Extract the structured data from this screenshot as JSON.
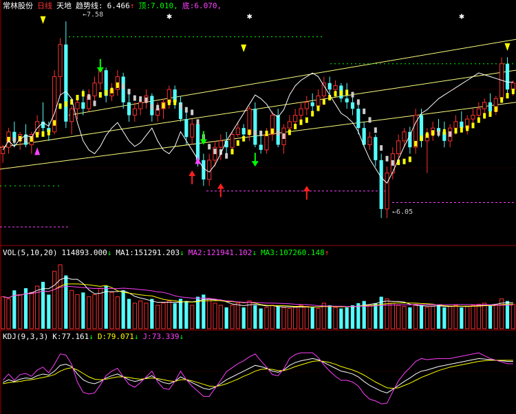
{
  "stock": {
    "name": "常林股份",
    "period": "日线",
    "indicator": "天地",
    "trend_label": "趋势线:",
    "trend_value": "6.466",
    "top_label": "顶:",
    "top_value": "7.010,",
    "bottom_label": "底:",
    "bottom_value": "6.070,",
    "down_arrow": "↓",
    "up_arrow": "↑"
  },
  "price_annotations": {
    "high": "7.58",
    "low": "6.05"
  },
  "volume": {
    "title": "VOL(5,10,20)",
    "vol_value": "114893.000",
    "ma1_label": "MA1:",
    "ma1_value": "151291.203",
    "ma2_label": "MA2:",
    "ma2_value": "121941.102",
    "ma3_label": "MA3:",
    "ma3_value": "107260.148"
  },
  "kdj": {
    "title": "KDJ(9,3,3)",
    "k_label": "K:",
    "k_value": "77.161",
    "d_label": "D:",
    "d_value": "79.071",
    "j_label": "J:",
    "j_value": "73.339"
  },
  "colors": {
    "background": "#000000",
    "up_candle": "#ff3030",
    "down_candle": "#54ffff",
    "trend_up": "#ffff00",
    "trend_down": "#cccccc",
    "channel": "#ffff80",
    "top_line": "#00ff00",
    "bottom_line": "#ff40ff",
    "kdj_k": "#ffffff",
    "kdj_d": "#ffff00",
    "kdj_j": "#ff40ff",
    "grid": "#a00000"
  },
  "chart_data": {
    "type": "candlestick",
    "price_range": [
      5.9,
      7.65
    ],
    "volume_range": [
      0,
      300000
    ],
    "kdj_range": [
      -10,
      110
    ],
    "candles": [
      [
        6.55,
        6.62,
        6.48,
        6.6
      ],
      [
        6.6,
        6.75,
        6.55,
        6.72
      ],
      [
        6.72,
        6.8,
        6.6,
        6.65
      ],
      [
        6.65,
        6.72,
        6.58,
        6.7
      ],
      [
        6.7,
        6.78,
        6.6,
        6.62
      ],
      [
        6.62,
        6.72,
        6.55,
        6.7
      ],
      [
        6.7,
        6.85,
        6.68,
        6.8
      ],
      [
        6.8,
        6.95,
        6.7,
        6.75
      ],
      [
        6.75,
        6.8,
        6.65,
        6.72
      ],
      [
        6.72,
        7.2,
        6.7,
        7.15
      ],
      [
        7.15,
        7.45,
        7.0,
        7.4
      ],
      [
        7.4,
        7.58,
        6.75,
        6.8
      ],
      [
        6.8,
        6.92,
        6.7,
        6.9
      ],
      [
        6.9,
        6.98,
        6.82,
        6.95
      ],
      [
        6.95,
        7.05,
        6.85,
        6.9
      ],
      [
        6.9,
        7.05,
        6.88,
        7.0
      ],
      [
        7.0,
        7.15,
        6.95,
        7.1
      ],
      [
        7.1,
        7.25,
        7.05,
        7.2
      ],
      [
        7.2,
        7.22,
        6.95,
        7.0
      ],
      [
        7.0,
        7.1,
        6.96,
        7.05
      ],
      [
        7.05,
        7.2,
        7.0,
        7.15
      ],
      [
        7.15,
        7.18,
        6.9,
        6.95
      ],
      [
        6.95,
        7.02,
        6.8,
        6.85
      ],
      [
        6.85,
        6.95,
        6.8,
        6.9
      ],
      [
        6.9,
        7.0,
        6.85,
        6.95
      ],
      [
        6.95,
        7.05,
        6.9,
        7.0
      ],
      [
        7.0,
        7.02,
        6.8,
        6.85
      ],
      [
        6.85,
        6.95,
        6.8,
        6.9
      ],
      [
        6.9,
        6.98,
        6.82,
        6.95
      ],
      [
        6.95,
        7.08,
        6.9,
        7.05
      ],
      [
        7.05,
        7.08,
        6.9,
        6.95
      ],
      [
        6.95,
        7.0,
        6.8,
        6.82
      ],
      [
        6.82,
        6.9,
        6.62,
        6.68
      ],
      [
        6.68,
        6.82,
        6.62,
        6.78
      ],
      [
        6.78,
        6.8,
        6.45,
        6.5
      ],
      [
        6.5,
        6.55,
        6.3,
        6.35
      ],
      [
        6.35,
        6.55,
        6.3,
        6.5
      ],
      [
        6.5,
        6.65,
        6.45,
        6.6
      ],
      [
        6.6,
        6.7,
        6.5,
        6.65
      ],
      [
        6.65,
        6.72,
        6.55,
        6.6
      ],
      [
        6.6,
        6.72,
        6.55,
        6.7
      ],
      [
        6.7,
        6.8,
        6.68,
        6.75
      ],
      [
        6.75,
        6.78,
        6.65,
        6.7
      ],
      [
        6.7,
        6.92,
        6.65,
        6.9
      ],
      [
        6.9,
        6.95,
        6.6,
        6.62
      ],
      [
        6.62,
        6.72,
        6.55,
        6.58
      ],
      [
        6.58,
        6.75,
        6.55,
        6.7
      ],
      [
        6.7,
        6.88,
        6.65,
        6.85
      ],
      [
        6.85,
        6.9,
        6.6,
        6.62
      ],
      [
        6.62,
        6.78,
        6.55,
        6.75
      ],
      [
        6.75,
        6.85,
        6.7,
        6.8
      ],
      [
        6.8,
        6.9,
        6.75,
        6.85
      ],
      [
        6.85,
        6.95,
        6.8,
        6.9
      ],
      [
        6.9,
        7.0,
        6.85,
        6.95
      ],
      [
        6.95,
        7.02,
        6.88,
        6.92
      ],
      [
        6.92,
        7.05,
        6.9,
        7.0
      ],
      [
        7.0,
        7.15,
        6.95,
        7.1
      ],
      [
        7.1,
        7.15,
        7.0,
        7.05
      ],
      [
        7.05,
        7.12,
        7.02,
        7.08
      ],
      [
        7.08,
        7.1,
        6.95,
        6.98
      ],
      [
        6.98,
        7.1,
        6.9,
        6.95
      ],
      [
        6.95,
        7.0,
        6.85,
        6.9
      ],
      [
        6.9,
        6.95,
        6.7,
        6.75
      ],
      [
        6.75,
        6.8,
        6.6,
        6.62
      ],
      [
        6.62,
        6.72,
        6.58,
        6.68
      ],
      [
        6.68,
        6.7,
        6.45,
        6.5
      ],
      [
        6.5,
        6.55,
        6.05,
        6.12
      ],
      [
        6.12,
        6.45,
        6.05,
        6.4
      ],
      [
        6.4,
        6.6,
        6.35,
        6.55
      ],
      [
        6.55,
        6.7,
        6.5,
        6.65
      ],
      [
        6.65,
        6.75,
        6.6,
        6.72
      ],
      [
        6.72,
        6.76,
        6.55,
        6.6
      ],
      [
        6.6,
        6.9,
        6.55,
        6.85
      ],
      [
        6.85,
        6.9,
        6.6,
        6.65
      ],
      [
        6.65,
        6.75,
        6.4,
        6.7
      ],
      [
        6.7,
        6.8,
        6.65,
        6.75
      ],
      [
        6.75,
        6.82,
        6.68,
        6.72
      ],
      [
        6.72,
        6.8,
        6.6,
        6.65
      ],
      [
        6.65,
        6.78,
        6.6,
        6.75
      ],
      [
        6.75,
        6.85,
        6.7,
        6.8
      ],
      [
        6.8,
        6.88,
        6.72,
        6.75
      ],
      [
        6.75,
        6.85,
        6.7,
        6.82
      ],
      [
        6.82,
        6.9,
        6.75,
        6.85
      ],
      [
        6.85,
        6.95,
        6.8,
        6.9
      ],
      [
        6.9,
        6.98,
        6.85,
        6.95
      ],
      [
        6.95,
        7.02,
        6.85,
        6.88
      ],
      [
        6.88,
        7.0,
        6.85,
        6.98
      ],
      [
        6.98,
        7.3,
        6.95,
        7.25
      ],
      [
        7.25,
        7.3,
        7.0,
        7.05
      ],
      [
        7.05,
        7.12,
        7.0,
        7.1
      ]
    ],
    "volumes": [
      150000,
      140000,
      180000,
      160000,
      190000,
      170000,
      200000,
      220000,
      160000,
      270000,
      300000,
      250000,
      180000,
      160000,
      170000,
      150000,
      160000,
      190000,
      200000,
      170000,
      150000,
      180000,
      140000,
      120000,
      130000,
      120000,
      140000,
      110000,
      120000,
      130000,
      120000,
      140000,
      130000,
      110000,
      150000,
      160000,
      140000,
      120000,
      110000,
      100000,
      110000,
      120000,
      100000,
      130000,
      110000,
      95000,
      100000,
      110000,
      105000,
      100000,
      95000,
      100000,
      110000,
      105000,
      100000,
      95000,
      120000,
      110000,
      100000,
      95000,
      100000,
      110000,
      120000,
      130000,
      110000,
      120000,
      150000,
      140000,
      120000,
      110000,
      105000,
      100000,
      115000,
      110000,
      100000,
      105000,
      110000,
      100000,
      105000,
      110000,
      100000,
      105000,
      110000,
      115000,
      120000,
      110000,
      115000,
      140000,
      130000,
      114893
    ],
    "kdj_k": [
      40,
      45,
      42,
      46,
      48,
      47,
      52,
      55,
      53,
      60,
      70,
      72,
      68,
      55,
      45,
      40,
      38,
      42,
      48,
      52,
      55,
      50,
      45,
      42,
      44,
      48,
      52,
      45,
      40,
      38,
      42,
      50,
      45,
      40,
      35,
      30,
      28,
      32,
      38,
      45,
      50,
      55,
      60,
      65,
      70,
      68,
      65,
      60,
      58,
      62,
      70,
      75,
      78,
      80,
      82,
      80,
      75,
      70,
      65,
      60,
      58,
      55,
      50,
      42,
      35,
      30,
      25,
      22,
      28,
      35,
      42,
      48,
      55,
      60,
      62,
      65,
      68,
      70,
      72,
      74,
      76,
      78,
      80,
      82,
      81,
      80,
      79,
      78,
      77,
      77
    ],
    "kdj_d": [
      38,
      40,
      41,
      42,
      44,
      45,
      47,
      49,
      51,
      54,
      60,
      64,
      66,
      62,
      56,
      50,
      46,
      45,
      46,
      48,
      50,
      50,
      49,
      47,
      46,
      47,
      48,
      47,
      45,
      43,
      42,
      45,
      45,
      43,
      40,
      37,
      34,
      33,
      35,
      38,
      42,
      46,
      51,
      55,
      60,
      63,
      64,
      63,
      61,
      61,
      64,
      68,
      71,
      74,
      77,
      78,
      77,
      75,
      72,
      68,
      65,
      62,
      58,
      53,
      47,
      41,
      36,
      31,
      30,
      31,
      35,
      39,
      44,
      49,
      53,
      57,
      61,
      64,
      67,
      69,
      71,
      73,
      75,
      77,
      78,
      79,
      79,
      79,
      79,
      79
    ],
    "kdj_j": [
      44,
      55,
      44,
      54,
      56,
      51,
      62,
      67,
      57,
      72,
      90,
      88,
      72,
      41,
      23,
      20,
      22,
      36,
      52,
      60,
      65,
      50,
      37,
      32,
      40,
      50,
      60,
      41,
      30,
      28,
      42,
      60,
      45,
      34,
      25,
      16,
      16,
      30,
      44,
      59,
      66,
      73,
      78,
      85,
      90,
      78,
      67,
      54,
      52,
      64,
      82,
      89,
      92,
      92,
      92,
      84,
      71,
      60,
      51,
      44,
      44,
      41,
      34,
      20,
      11,
      8,
      3,
      4,
      24,
      43,
      56,
      66,
      77,
      82,
      80,
      81,
      82,
      82,
      82,
      84,
      86,
      88,
      90,
      92,
      87,
      82,
      79,
      76,
      73,
      73
    ]
  }
}
